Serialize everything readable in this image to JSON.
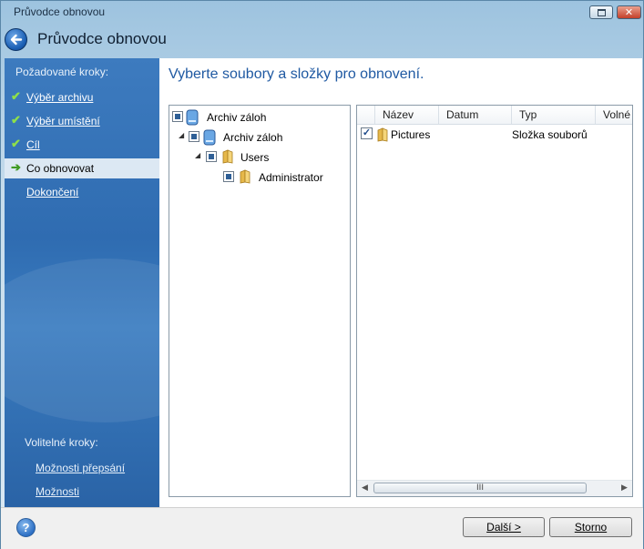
{
  "window": {
    "title": "Průvodce obnovou",
    "close_glyph": "✕"
  },
  "header": {
    "title": "Průvodce obnovou"
  },
  "sidebar": {
    "required_label": "Požadované kroky:",
    "items": [
      {
        "label": "Výběr archivu",
        "state": "done"
      },
      {
        "label": "Výběr umístění",
        "state": "done"
      },
      {
        "label": "Cíl",
        "state": "done"
      },
      {
        "label": "Co obnovovat",
        "state": "current"
      },
      {
        "label": "Dokončení",
        "state": "pending"
      }
    ],
    "optional_label": "Volitelné kroky:",
    "optional_items": [
      {
        "label": "Možnosti přepsání"
      },
      {
        "label": "Možnosti"
      }
    ]
  },
  "content": {
    "title": "Vyberte soubory a složky pro obnovení."
  },
  "tree": {
    "nodes": [
      {
        "label": "Archiv záloh",
        "icon": "drive-icon",
        "depth": 0
      },
      {
        "label": "Archiv záloh",
        "icon": "drive-icon",
        "depth": 1
      },
      {
        "label": "Users",
        "icon": "folder-icon",
        "depth": 2
      },
      {
        "label": "Administrator",
        "icon": "folder-icon",
        "depth": 3
      }
    ]
  },
  "list": {
    "columns": [
      "Název",
      "Datum",
      "Typ",
      "Volné"
    ],
    "rows": [
      {
        "checked": true,
        "name": "Pictures",
        "date": "",
        "type": "Složka souborů"
      }
    ],
    "scroll_grip": "III"
  },
  "footer": {
    "help_glyph": "?",
    "next_label": "Další >",
    "cancel_label": "Storno"
  },
  "colors": {
    "sidebar_bg": "#2f6cb1",
    "title_text": "#1f59a2",
    "check_green": "#8ee04a"
  }
}
